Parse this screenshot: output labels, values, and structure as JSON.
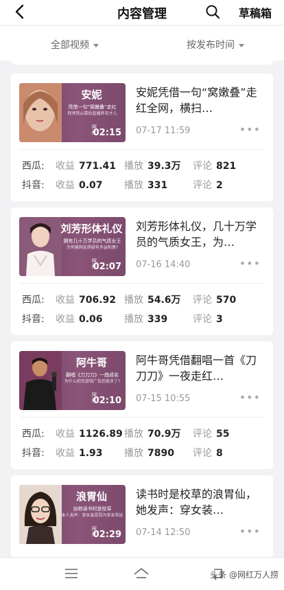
{
  "header": {
    "title": "内容管理",
    "drafts": "草稿箱"
  },
  "filters": {
    "category": "全部视频",
    "sort": "按发布时间"
  },
  "labels": {
    "revenue": "收益",
    "plays": "播放",
    "comments": "评论"
  },
  "videos": [
    {
      "thumb_name": "安妮",
      "thumb_sub": "凭借一句“窝嫩叠”走红",
      "thumb_sub2": "拜师铁山靠后直播养天才儿",
      "duration": "02:15",
      "title": "安妮凭借一句“窝嫩叠”走红全网，横扫…",
      "date": "07-17 11:59",
      "stats": [
        {
          "platform": "西瓜:",
          "revenue": "771.41",
          "plays": "39.3万",
          "comments": "821"
        },
        {
          "platform": "抖音:",
          "revenue": "0.07",
          "plays": "331",
          "comments": "2"
        }
      ]
    },
    {
      "thumb_name": "刘芳形体礼仪",
      "thumb_sub": "拥有几十万学员的气质女王",
      "thumb_sub2": "为何被网友质疑有多益削痩?",
      "duration": "02:07",
      "title": "刘芳形体礼仪，几十万学员的气质女王，为…",
      "date": "07-16 14:40",
      "stats": [
        {
          "platform": "西瓜:",
          "revenue": "706.92",
          "plays": "54.6万",
          "comments": "570"
        },
        {
          "platform": "抖音:",
          "revenue": "0.06",
          "plays": "339",
          "comments": "3"
        }
      ]
    },
    {
      "thumb_name": "阿牛哥",
      "thumb_sub": "翻唱《刀刀刀》一曲成名",
      "thumb_sub2": "为什么拍完游戏广告后就凉了?",
      "duration": "02:10",
      "title": "阿牛哥凭借翻唱一首《刀刀刀》一夜走红…",
      "date": "07-15 10:55",
      "stats": [
        {
          "platform": "西瓜:",
          "revenue": "1126.89",
          "plays": "70.9万",
          "comments": "55"
        },
        {
          "platform": "抖音:",
          "revenue": "1.93",
          "plays": "7890",
          "comments": "8"
        }
      ]
    },
    {
      "thumb_name": "浪胃仙",
      "thumb_sub": "自称读书时是校草",
      "thumb_sub2": "本人发声：穿女装是因为单亲带娃",
      "duration": "02:29",
      "title": "读书时是校草的浪胃仙，她发声：穿女装…",
      "date": "07-14 12:50",
      "stats": []
    }
  ],
  "watermark": "头条 @网红万人捞",
  "thumb_watermark": "阿红",
  "colors": {
    "thumb_bg": "#7b4a6c",
    "accent": "#222222"
  },
  "icons": [
    "back-icon",
    "search-icon",
    "menu-icon",
    "home-icon",
    "return-icon",
    "more-icon"
  ]
}
